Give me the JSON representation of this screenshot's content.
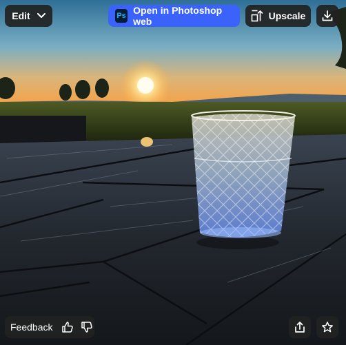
{
  "toolbar": {
    "edit_label": "Edit",
    "photoshop_label": "Open in Photoshop web",
    "photoshop_badge": "Ps",
    "upscale_label": "Upscale"
  },
  "bottom_bar": {
    "feedback_label": "Feedback"
  },
  "icons": {
    "edit": "chevron-down-icon",
    "upscale": "upscale-icon",
    "download": "download-icon",
    "like": "thumbs-up-icon",
    "dislike": "thumbs-down-icon",
    "share": "share-icon",
    "favorite": "star-icon"
  },
  "colors": {
    "accent": "#3b63fb",
    "button_bg": "#222222",
    "photoshop_logo_bg": "#001e36",
    "photoshop_logo_fg": "#31a8ff"
  }
}
